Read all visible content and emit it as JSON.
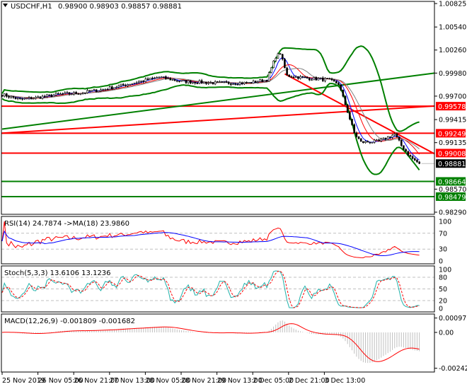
{
  "chart_header": {
    "symbol": "USDCHF,H1",
    "ohlc": "0.98900 0.98903 0.98857 0.98881",
    "arrow_icon": "triangle-down"
  },
  "chart_data": [
    {
      "type": "candlestick",
      "title": "USDCHF,H1 0.98900 0.98903 0.98857 0.98881",
      "ylim": [
        0.9829,
        1.00825
      ],
      "y_ticks": [
        "1.00825",
        "1.00540",
        "1.00260",
        "0.99980",
        "0.99700",
        "0.99415",
        "0.99135",
        "0.98570",
        "0.98290"
      ],
      "x_ticks": [
        "25 Nov 2019",
        "26 Nov 05:00",
        "26 Nov 21:00",
        "27 Nov 13:00",
        "28 Nov 05:00",
        "28 Nov 21:00",
        "29 Nov 13:00",
        "2 Dec 05:00",
        "2 Dec 21:00",
        "3 Dec 13:00"
      ],
      "current_price": "0.98881",
      "close_path": [
        [
          0,
          0.9972
        ],
        [
          8,
          0.9966
        ],
        [
          15,
          0.9968
        ],
        [
          25,
          0.9972
        ],
        [
          35,
          0.9974
        ],
        [
          45,
          0.9978
        ],
        [
          55,
          0.9984
        ],
        [
          65,
          0.999
        ],
        [
          70,
          0.9993
        ],
        [
          80,
          0.9988
        ],
        [
          95,
          0.9986
        ],
        [
          110,
          0.9986
        ],
        [
          118,
          0.999
        ],
        [
          122,
          1.0018
        ],
        [
          124,
          1.0022
        ],
        [
          127,
          0.9995
        ],
        [
          135,
          0.9992
        ],
        [
          145,
          0.999
        ],
        [
          150,
          0.9985
        ],
        [
          153,
          0.996
        ],
        [
          157,
          0.9925
        ],
        [
          160,
          0.9914
        ],
        [
          168,
          0.9915
        ],
        [
          172,
          0.992
        ],
        [
          175,
          0.9924
        ],
        [
          178,
          0.991
        ],
        [
          182,
          0.9896
        ],
        [
          186,
          0.98881
        ]
      ],
      "levels": [
        {
          "value": "0.99578",
          "color": "#ff0000"
        },
        {
          "value": "0.99249",
          "color": "#ff0000"
        },
        {
          "value": "0.99008",
          "color": "#ff0000"
        },
        {
          "value": "0.98664",
          "color": "#008000"
        },
        {
          "value": "0.98479",
          "color": "#008000"
        }
      ],
      "trendlines": [
        {
          "color": "#ff0000",
          "from": [
            0,
            0.9925
          ],
          "to": [
            193,
            0.9958
          ]
        },
        {
          "color": "#008000",
          "from": [
            0,
            0.993
          ],
          "to": [
            193,
            0.9998
          ]
        },
        {
          "color": "#ff0000",
          "from": [
            126,
            0.9997
          ],
          "to": [
            193,
            0.99
          ]
        }
      ]
    },
    {
      "type": "line",
      "title": "RSI(14) 24.7874 ->MA(18) 23.9860",
      "ylim": [
        0,
        100
      ],
      "y_ticks": [
        "100",
        "70",
        "30",
        "0"
      ]
    },
    {
      "type": "line",
      "title": "Stoch(5,3,3) 13.6106 13.1236",
      "ylim": [
        0,
        100
      ],
      "y_ticks": [
        "100",
        "80",
        "50",
        "20",
        "0"
      ]
    },
    {
      "type": "bar",
      "title": "MACD(12,26,9) -0.001809 -0.001682",
      "ylim": [
        -0.002427,
        0.000975
      ],
      "y_ticks": [
        "0.000975",
        "0.00",
        "-0.002427"
      ]
    }
  ],
  "colors": {
    "bull": "#008000",
    "bear": "#000000",
    "level_red": "#ff0000",
    "level_green": "#008000",
    "rsi": "#0000ff",
    "signal": "#ff0000",
    "stoch": "#20b2aa",
    "macd_hist": "#c0c0c0"
  }
}
